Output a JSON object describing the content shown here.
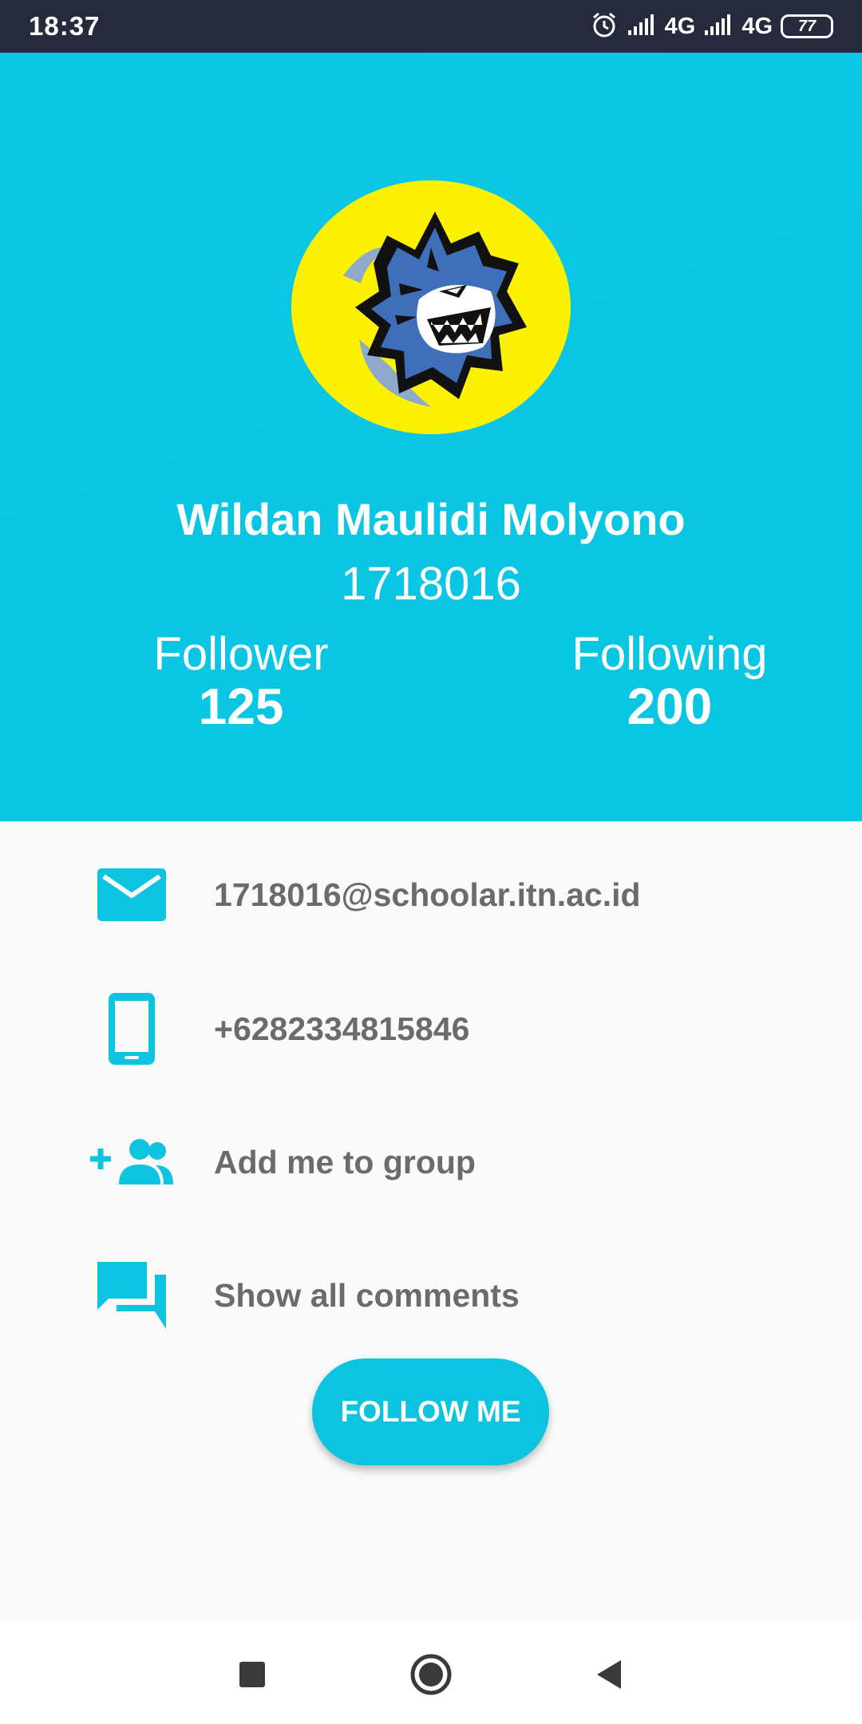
{
  "status_bar": {
    "time": "18:37",
    "network_1": "4G",
    "network_2": "4G",
    "battery": "77"
  },
  "profile": {
    "name": "Wildan Maulidi Molyono",
    "id": "1718016",
    "followers_label": "Follower",
    "followers_value": "125",
    "following_label": "Following",
    "following_value": "200"
  },
  "contact": {
    "email": "1718016@schoolar.itn.ac.id",
    "phone": "+6282334815846",
    "add_group": "Add me to group",
    "comments": "Show all comments"
  },
  "follow_button": "FOLLOW ME",
  "icons": {
    "email": "email-icon",
    "phone": "phone-icon",
    "group": "group-add-icon",
    "comments": "comments-icon"
  },
  "colors": {
    "accent": "#0cc8e4",
    "status_bar": "#272a3c",
    "avatar_bg": "#fbf101",
    "text_gray": "#6b6b6b"
  }
}
